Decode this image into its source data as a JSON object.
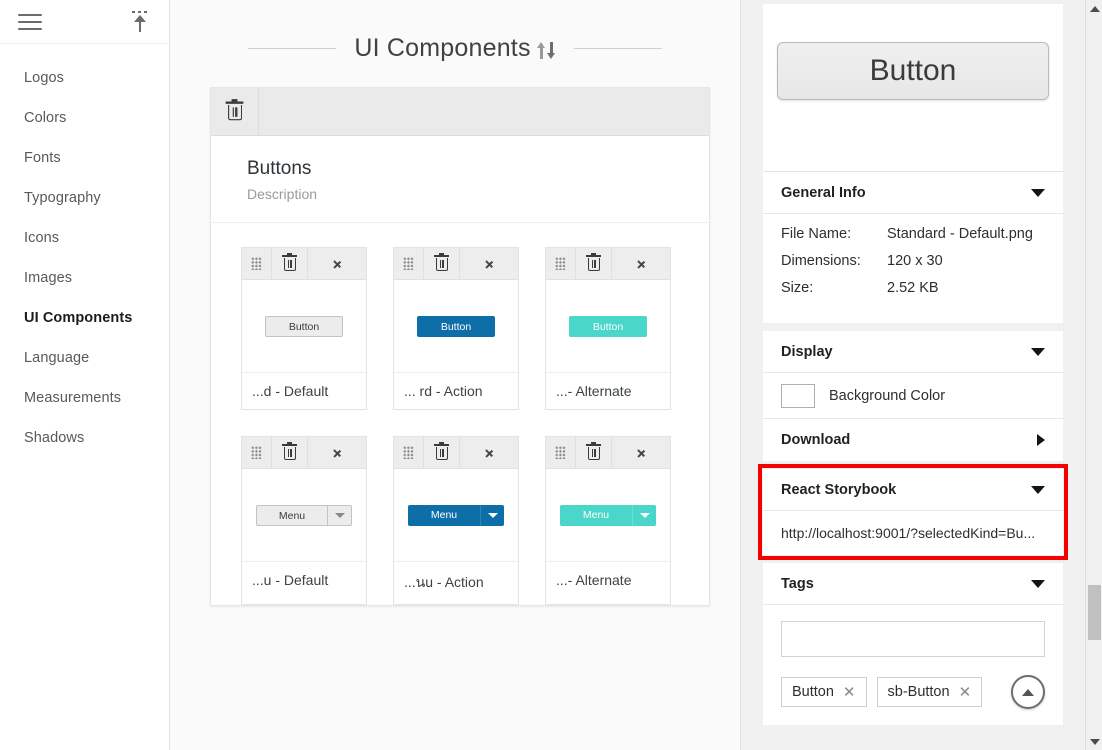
{
  "sidebar": {
    "menu_icon": "hamburger-icon",
    "upload_icon": "upload-icon",
    "items": [
      {
        "label": "Logos",
        "active": false
      },
      {
        "label": "Colors",
        "active": false
      },
      {
        "label": "Fonts",
        "active": false
      },
      {
        "label": "Typography",
        "active": false
      },
      {
        "label": "Icons",
        "active": false
      },
      {
        "label": "Images",
        "active": false
      },
      {
        "label": "UI Components",
        "active": true
      },
      {
        "label": "Language",
        "active": false
      },
      {
        "label": "Measurements",
        "active": false
      },
      {
        "label": "Shadows",
        "active": false
      }
    ]
  },
  "main": {
    "title": "UI Components",
    "sort_icon": "sort-updown-icon",
    "group": {
      "delete_icon": "trash-icon",
      "title": "Buttons",
      "description": "Description"
    },
    "tiles": [
      {
        "label": "...d - Default",
        "kind": "button",
        "variant": "default",
        "sample_text": "Button"
      },
      {
        "label": "... rd - Action",
        "kind": "button",
        "variant": "action",
        "sample_text": "Button"
      },
      {
        "label": "...- Alternate",
        "kind": "button",
        "variant": "alt",
        "sample_text": "Button"
      },
      {
        "label": "...u - Default",
        "kind": "split",
        "variant": "default",
        "sample_text": "Menu"
      },
      {
        "label": "...นu - Action",
        "kind": "split",
        "variant": "action",
        "sample_text": "Menu"
      },
      {
        "label": "...- Alternate",
        "kind": "split",
        "variant": "alt",
        "sample_text": "Menu"
      }
    ]
  },
  "inspector": {
    "preview": {
      "label": "Button"
    },
    "general_info": {
      "heading": "General Info",
      "expanded": true,
      "rows": [
        {
          "key": "File Name:",
          "value": "Standard - Default.png"
        },
        {
          "key": "Dimensions:",
          "value": "120 x 30"
        },
        {
          "key": "Size:",
          "value": "2.52 KB"
        }
      ]
    },
    "display": {
      "heading": "Display",
      "expanded": true,
      "background_color_label": "Background Color",
      "background_color_value": "#ffffff"
    },
    "download": {
      "heading": "Download",
      "expanded": false
    },
    "react_storybook": {
      "heading": "React Storybook",
      "expanded": true,
      "url": "http://localhost:9001/?selectedKind=Bu...",
      "highlight_color": "#f70000"
    },
    "tags": {
      "heading": "Tags",
      "expanded": true,
      "input_value": "",
      "input_placeholder": "",
      "items": [
        {
          "label": "Button",
          "remove_icon": "close-icon"
        },
        {
          "label": "sb-Button",
          "remove_icon": "close-icon"
        }
      ],
      "collapse_icon": "chevron-up-circle-icon"
    }
  },
  "scrollbar": {
    "up_icon": "triangle-up-icon",
    "down_icon": "triangle-down-icon"
  },
  "colors": {
    "action": "#0d6ea8",
    "alternate": "#4ad6c8",
    "default_button": "#ececec",
    "highlight": "#f70000"
  }
}
